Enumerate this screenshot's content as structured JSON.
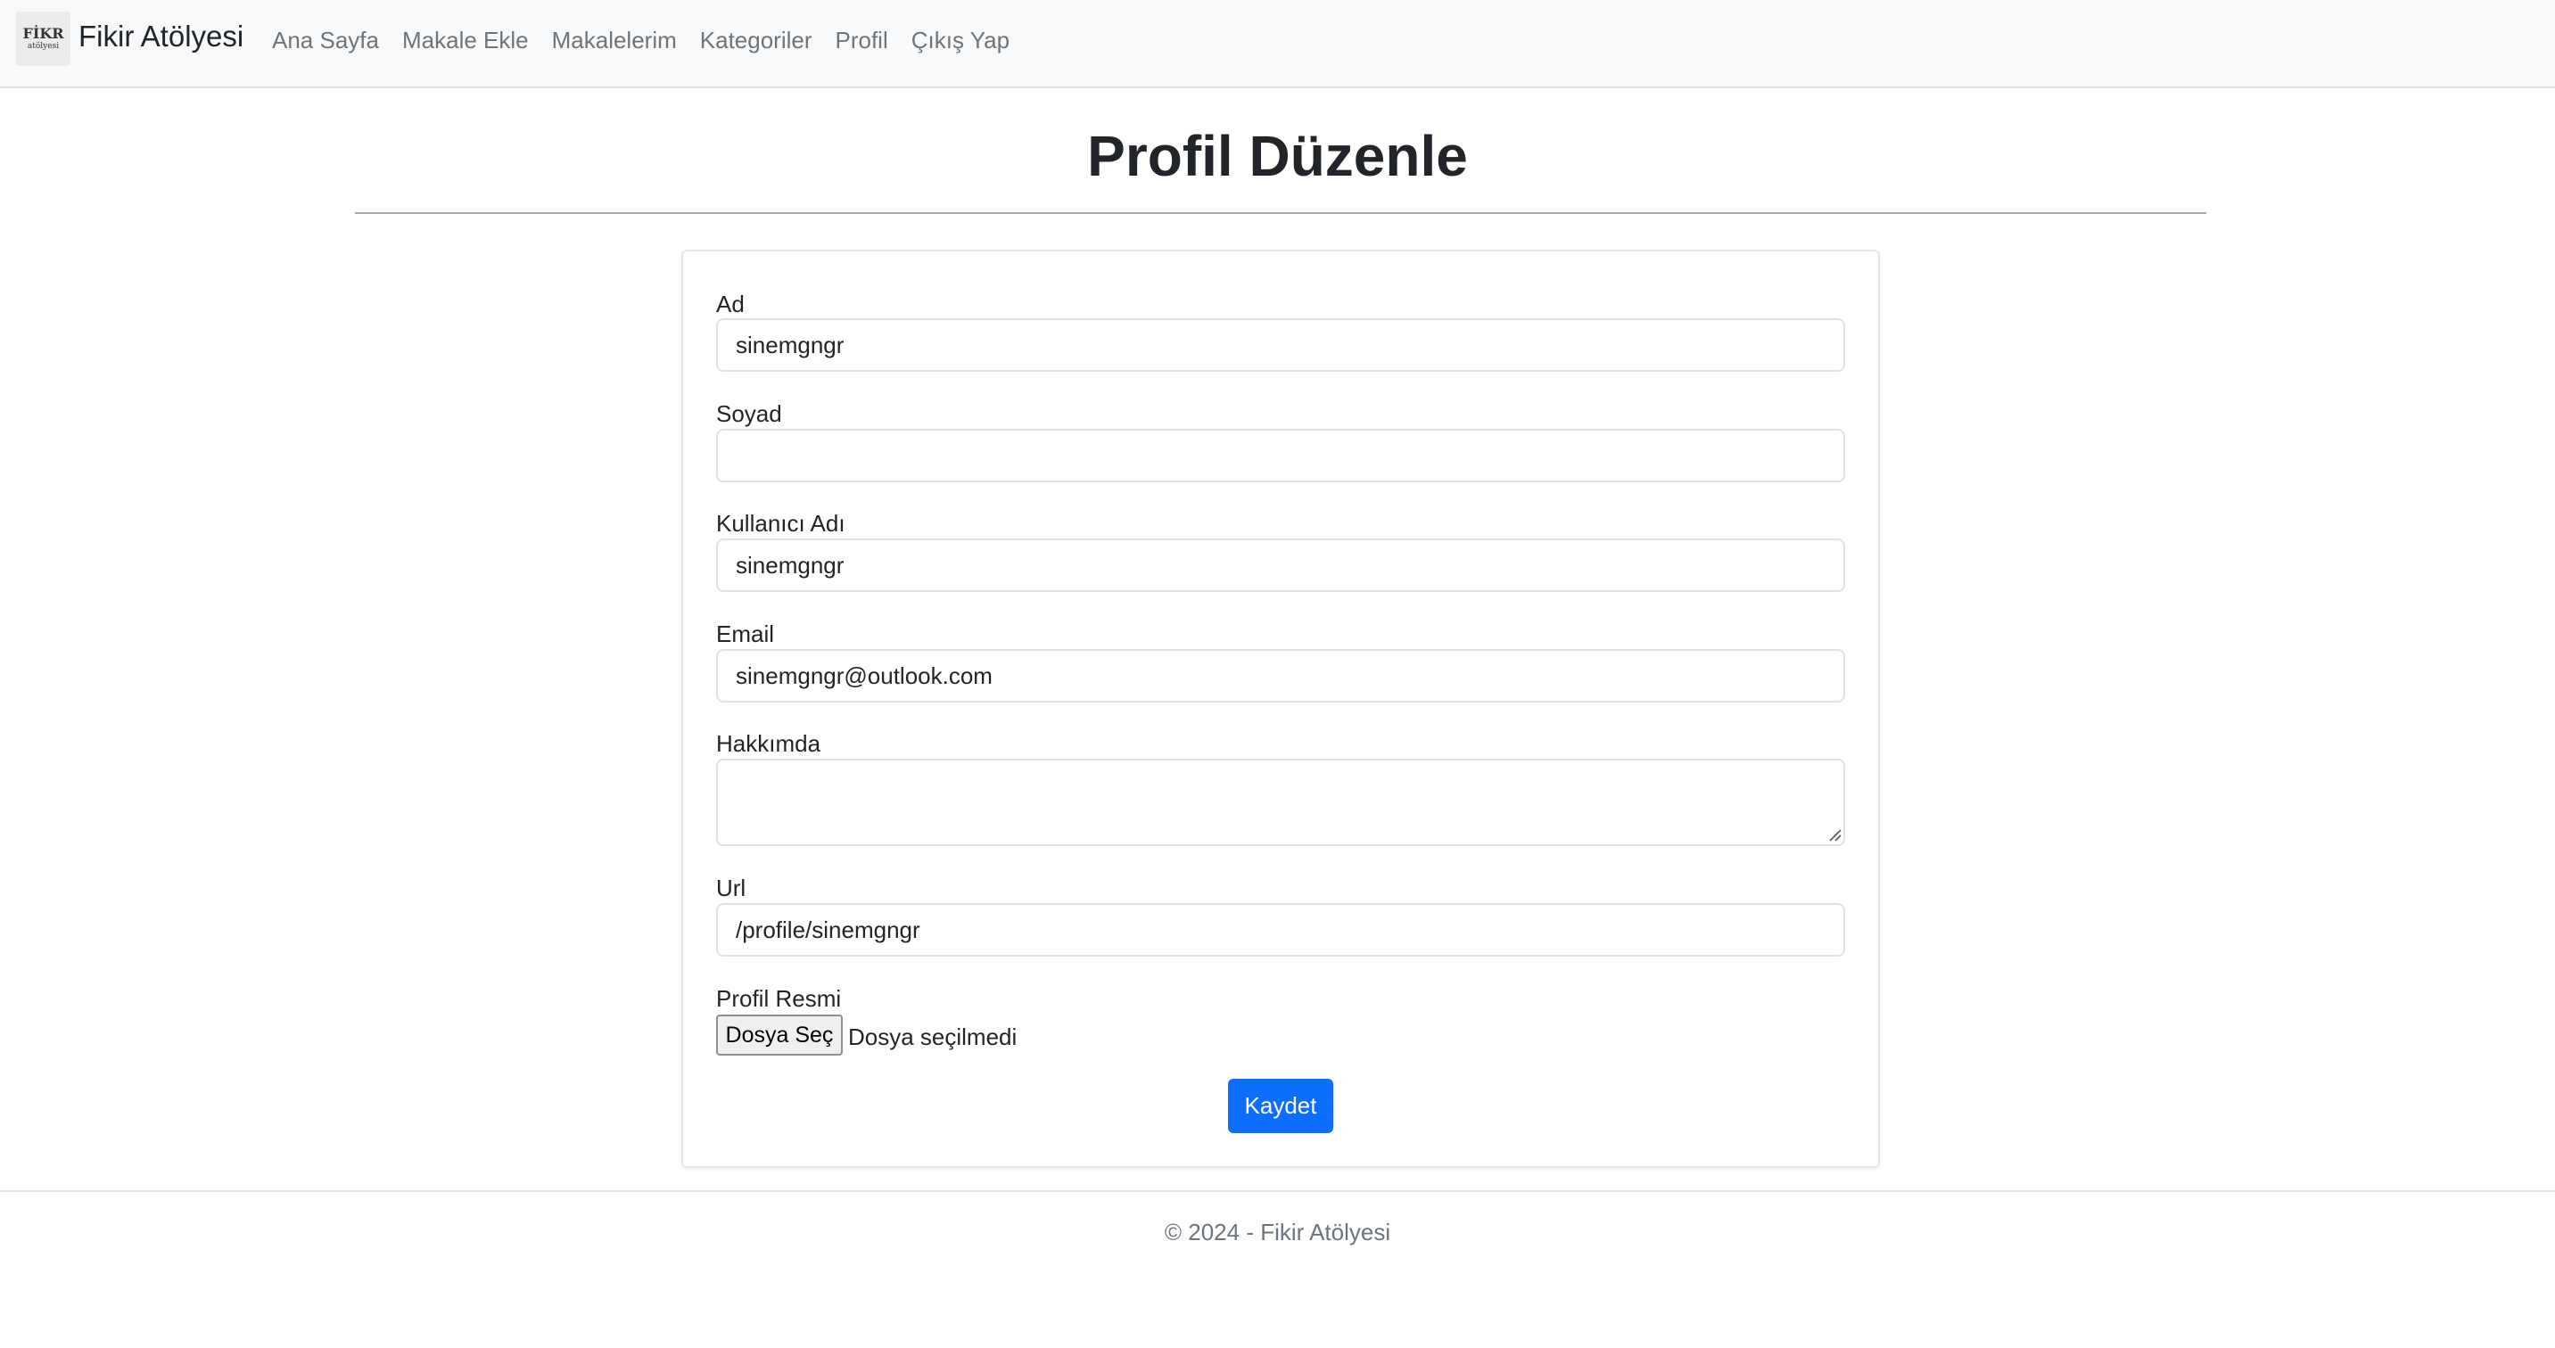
{
  "navbar": {
    "logo_text": "FİKR",
    "logo_subtext": "atölyesi",
    "brand": "Fikir Atölyesi",
    "links": [
      "Ana Sayfa",
      "Makale Ekle",
      "Makalelerim",
      "Kategoriler",
      "Profil",
      "Çıkış Yap"
    ]
  },
  "page": {
    "title": "Profil Düzenle"
  },
  "form": {
    "first_name": {
      "label": "Ad",
      "value": "sinemgngr"
    },
    "last_name": {
      "label": "Soyad",
      "value": ""
    },
    "username": {
      "label": "Kullanıcı Adı",
      "value": "sinemgngr"
    },
    "email": {
      "label": "Email",
      "value": "sinemgngr@outlook.com"
    },
    "about": {
      "label": "Hakkımda",
      "value": ""
    },
    "url": {
      "label": "Url",
      "value": "/profile/sinemgngr"
    },
    "profile_image": {
      "label": "Profil Resmi",
      "button_label": "Dosya Seç",
      "status": "Dosya seçilmedi"
    },
    "submit_label": "Kaydet"
  },
  "footer": {
    "text": "© 2024 - Fikir Atölyesi"
  },
  "colors": {
    "primary": "#0d6efd",
    "navbar_bg": "#f8f9fa",
    "muted_text": "#6c757d"
  }
}
